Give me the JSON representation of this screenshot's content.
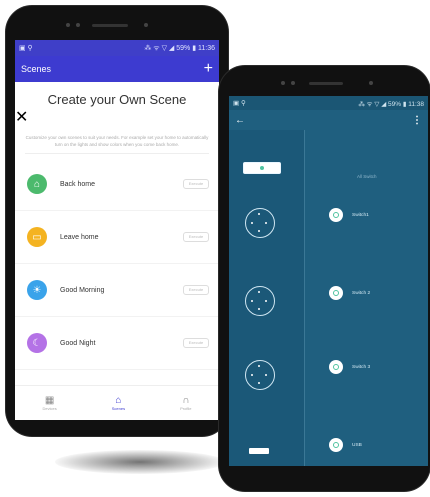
{
  "left_app": {
    "status_right": "⁂ ᯤ ▽ ◢ 59% ▮ 11:36",
    "title": "Scenes",
    "header": "Create your Own Scene",
    "description": "Customize your own scenes to suit your needs. For example set your home to automatically turn on the lights and show colors when you come back home.",
    "scenes": [
      {
        "label": "Back home",
        "icon": "home-icon",
        "color": "#4cba6d",
        "pill": "Execute"
      },
      {
        "label": "Leave home",
        "icon": "briefcase-icon",
        "color": "#f4b321",
        "pill": "Execute"
      },
      {
        "label": "Good Morning",
        "icon": "sun-icon",
        "color": "#3aa3ea",
        "pill": "Execute"
      },
      {
        "label": "Good Night",
        "icon": "moon-icon",
        "color": "#b472e6",
        "pill": "Execute"
      }
    ],
    "nav": [
      {
        "label": "Devices",
        "icon": "grid-icon",
        "active": false
      },
      {
        "label": "Scenes",
        "icon": "house-icon",
        "active": true
      },
      {
        "label": "Profile",
        "icon": "headphones-icon",
        "active": false
      }
    ]
  },
  "right_app": {
    "status_right": "⁂ ᯤ ▽ ◢ 59% ▮ 11:38",
    "all_label": "All Switch",
    "switches": [
      "Switch1",
      "Switch 2",
      "Switch 3",
      "USB"
    ]
  },
  "colors": {
    "left_accent": "#3d3bd0",
    "right_bg": "#1f5f7f"
  }
}
